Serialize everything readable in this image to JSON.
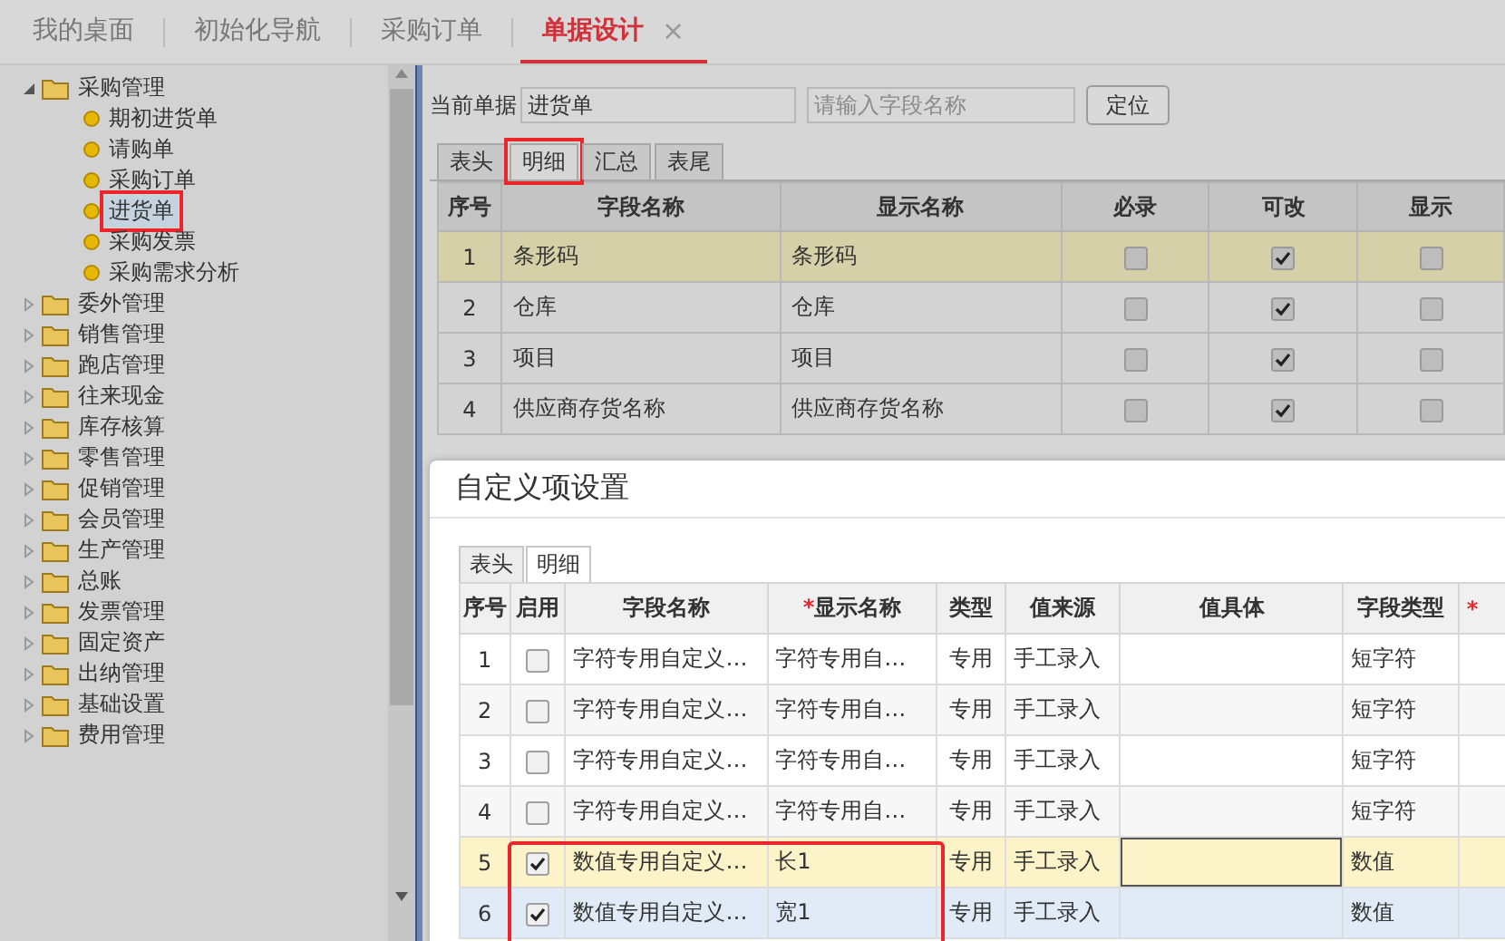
{
  "top_tabs": [
    {
      "label": "我的桌面",
      "selected": false,
      "closable": false
    },
    {
      "label": "初始化导航",
      "selected": false,
      "closable": false
    },
    {
      "label": "采购订单",
      "selected": false,
      "closable": false
    },
    {
      "label": "单据设计",
      "selected": true,
      "closable": true,
      "close": "×"
    }
  ],
  "tree": [
    {
      "label": "采购管理",
      "expanded": true,
      "children": [
        {
          "label": "期初进货单",
          "selected": false,
          "marked": false
        },
        {
          "label": "请购单",
          "selected": false,
          "marked": false
        },
        {
          "label": "采购订单",
          "selected": false,
          "marked": false
        },
        {
          "label": "进货单",
          "selected": true,
          "marked": true
        },
        {
          "label": "采购发票",
          "selected": false,
          "marked": false
        },
        {
          "label": "采购需求分析",
          "selected": false,
          "marked": false
        }
      ]
    },
    {
      "label": "委外管理",
      "expanded": false
    },
    {
      "label": "销售管理",
      "expanded": false
    },
    {
      "label": "跑店管理",
      "expanded": false
    },
    {
      "label": "往来现金",
      "expanded": false
    },
    {
      "label": "库存核算",
      "expanded": false
    },
    {
      "label": "零售管理",
      "expanded": false
    },
    {
      "label": "促销管理",
      "expanded": false
    },
    {
      "label": "会员管理",
      "expanded": false
    },
    {
      "label": "生产管理",
      "expanded": false
    },
    {
      "label": "总账",
      "expanded": false
    },
    {
      "label": "发票管理",
      "expanded": false
    },
    {
      "label": "固定资产",
      "expanded": false
    },
    {
      "label": "出纳管理",
      "expanded": false
    },
    {
      "label": "基础设置",
      "expanded": false
    },
    {
      "label": "费用管理",
      "expanded": false
    }
  ],
  "toolbar": {
    "label": "当前单据",
    "document": "进货单",
    "search_placeholder": "请输入字段名称",
    "locate_button": "定位"
  },
  "detail_tabs": [
    {
      "label": "表头",
      "selected": false,
      "marked": false
    },
    {
      "label": "明细",
      "selected": true,
      "marked": true
    },
    {
      "label": "汇总",
      "selected": false,
      "marked": false
    },
    {
      "label": "表尾",
      "selected": false,
      "marked": false
    }
  ],
  "fields_table": {
    "columns": [
      "序号",
      "字段名称",
      "显示名称",
      "必录",
      "可改",
      "显示"
    ],
    "rows": [
      {
        "no": "1",
        "field": "条形码",
        "display": "条形码",
        "required": false,
        "editable": true,
        "visible": false,
        "selected": true
      },
      {
        "no": "2",
        "field": "仓库",
        "display": "仓库",
        "required": false,
        "editable": true,
        "visible": false,
        "selected": false
      },
      {
        "no": "3",
        "field": "项目",
        "display": "项目",
        "required": false,
        "editable": true,
        "visible": false,
        "selected": false
      },
      {
        "no": "4",
        "field": "供应商存货名称",
        "display": "供应商存货名称",
        "required": false,
        "editable": true,
        "visible": false,
        "selected": false
      }
    ]
  },
  "dialog": {
    "title": "自定义项设置",
    "tabs": [
      {
        "label": "表头",
        "selected": false
      },
      {
        "label": "明细",
        "selected": true
      }
    ],
    "columns": [
      {
        "label": "序号"
      },
      {
        "label": "启用"
      },
      {
        "label": "字段名称"
      },
      {
        "label": "显示名称",
        "required_mark": "*"
      },
      {
        "label": "类型"
      },
      {
        "label": "值来源"
      },
      {
        "label": "值具体"
      },
      {
        "label": "字段类型"
      },
      {
        "required_mark": "*"
      }
    ],
    "rows": [
      {
        "no": "1",
        "enabled": false,
        "field": "字符专用自定义…",
        "display": "字符专用自…",
        "type": "专用",
        "source": "手工录入",
        "detail": "",
        "field_type": "短字符",
        "selected": false,
        "hovered": false,
        "marked": false
      },
      {
        "no": "2",
        "enabled": false,
        "field": "字符专用自定义…",
        "display": "字符专用自…",
        "type": "专用",
        "source": "手工录入",
        "detail": "",
        "field_type": "短字符",
        "selected": false,
        "hovered": false,
        "marked": false
      },
      {
        "no": "3",
        "enabled": false,
        "field": "字符专用自定义…",
        "display": "字符专用自…",
        "type": "专用",
        "source": "手工录入",
        "detail": "",
        "field_type": "短字符",
        "selected": false,
        "hovered": false,
        "marked": false
      },
      {
        "no": "4",
        "enabled": false,
        "field": "字符专用自定义…",
        "display": "字符专用自…",
        "type": "专用",
        "source": "手工录入",
        "detail": "",
        "field_type": "短字符",
        "selected": false,
        "hovered": false,
        "marked": false
      },
      {
        "no": "5",
        "enabled": true,
        "field": "数值专用自定义…",
        "display": "长1",
        "type": "专用",
        "source": "手工录入",
        "detail": "",
        "field_type": "数值",
        "selected": true,
        "hovered": false,
        "marked": true
      },
      {
        "no": "6",
        "enabled": true,
        "field": "数值专用自定义…",
        "display": "宽1",
        "type": "专用",
        "source": "手工录入",
        "detail": "",
        "field_type": "数值",
        "selected": false,
        "hovered": true,
        "marked": true
      }
    ]
  }
}
